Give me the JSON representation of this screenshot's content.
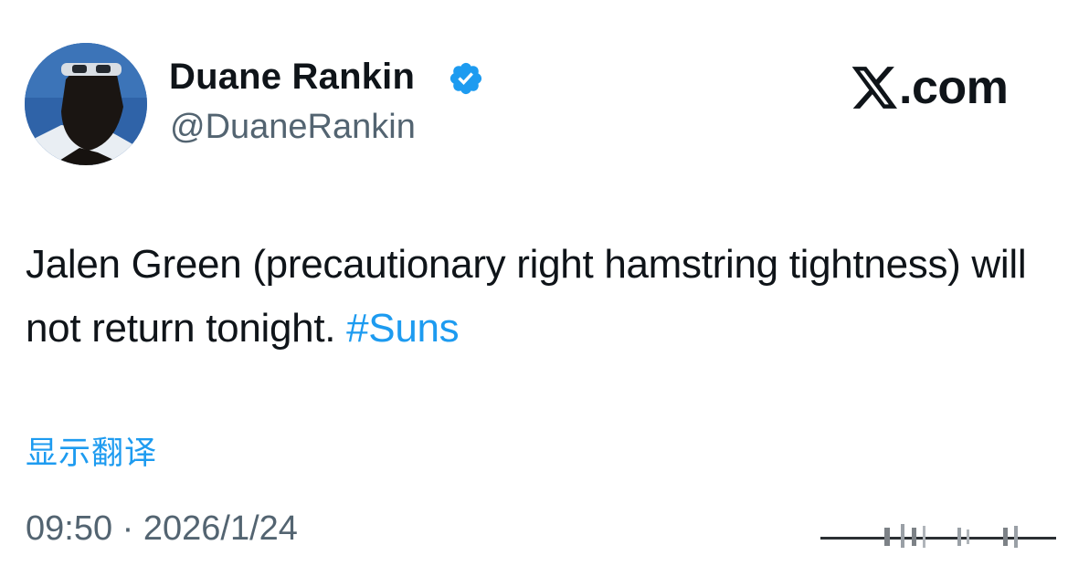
{
  "author": {
    "name": "Duane Rankin",
    "handle": "@DuaneRankin",
    "verified": true,
    "avatar_icon": "profile-photo"
  },
  "brand": {
    "logo_text": ".com",
    "logo_icon": "x-logo-icon"
  },
  "tweet": {
    "text_main": "Jalen Green (precautionary right hamstring tightness) will not return tonight. ",
    "hashtag": "#Suns",
    "translate_label": "显示翻译",
    "timestamp": "09:50 · 2026/1/24"
  },
  "colors": {
    "link": "#1d9bf0",
    "verified": "#1d9bf0",
    "text": "#0f1419",
    "secondary": "#536471"
  }
}
